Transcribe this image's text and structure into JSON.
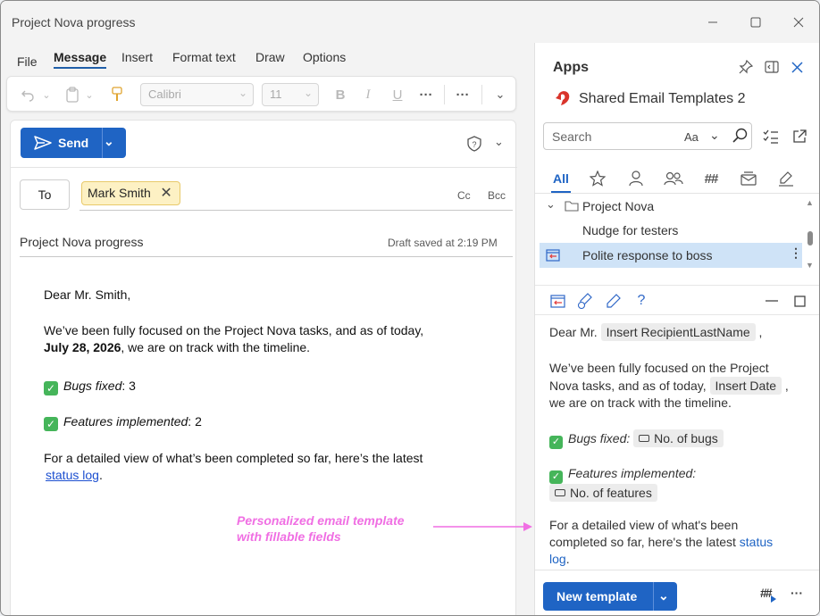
{
  "window": {
    "title": "Project Nova progress"
  },
  "menu": [
    "File",
    "Message",
    "Insert",
    "Format text",
    "Draw",
    "Options"
  ],
  "ribbon": {
    "font": "Calibri",
    "size": "11"
  },
  "compose": {
    "send_label": "Send",
    "to_label": "To",
    "recipient": "Mark Smith",
    "cc_label": "Cc",
    "bcc_label": "Bcc",
    "subject": "Project Nova progress",
    "draft_status": "Draft saved at 2:19 PM"
  },
  "email": {
    "greeting": "Dear Mr. Smith,",
    "para1_a": "We’ve been fully focused on the Project Nova tasks, and as of today,",
    "para1_date": "July 28, 2026",
    "para1_b": ",  we are on track with the timeline.",
    "bugs_label": "Bugs fixed",
    "bugs_value": ": 3",
    "features_label": "Features implemented",
    "features_value": ": 2",
    "para2": "For a detailed view of what’s been completed so far, here’s the latest",
    "link": "status log",
    "period": "."
  },
  "annotation": {
    "line1": "Personalized email template",
    "line2": "with fillable fields"
  },
  "panel": {
    "title": "Apps",
    "addin_name": "Shared Email Templates 2",
    "search_placeholder": "Search",
    "search_case": "Aa",
    "tab_all": "All",
    "folder": "Project Nova",
    "items": [
      "Nudge for testers",
      "Polite response to boss"
    ],
    "preview": {
      "dear": "Dear Mr.",
      "field_lastname": "Insert RecipientLastName",
      "comma": ",",
      "p1": "We’ve been fully focused on the Project Nova tasks, and as of today,",
      "field_date": "Insert Date",
      "p1_end": "we are on track with the timeline.",
      "bugs": "Bugs fixed:",
      "field_bugs": "No. of bugs",
      "features": "Features implemented:",
      "field_features": "No. of features",
      "p2": "For a detailed view of what's been completed so far, here's the latest",
      "link": "status",
      "link2": "log",
      "period": "."
    },
    "new_template": "New template"
  },
  "colors": {
    "accent": "#1f64c4",
    "annotation": "#f06fe3",
    "selection": "#cfe3f7"
  }
}
